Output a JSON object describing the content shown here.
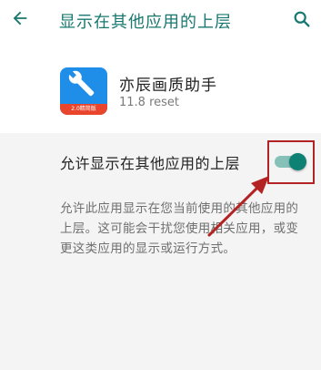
{
  "toolbar": {
    "title": "显示在其他应用的上层",
    "back_icon": "arrow-left-icon",
    "search_icon": "search-icon"
  },
  "app": {
    "name": "亦辰画质助手",
    "version": "11.8 reset",
    "icon": "wrench-icon",
    "icon_banner": "2.0精简版"
  },
  "setting": {
    "label": "允许显示在其他应用的上层",
    "enabled": true,
    "description": "允许此应用显示在您当前使用的其他应用的上层。这可能会干扰您使用相关应用，或变更这类应用的显示或运行方式。"
  },
  "colors": {
    "accent": "#18786f",
    "toggle_thumb": "#0d8173",
    "toggle_track": "#85c0b9",
    "annotation": "#b32324",
    "app_icon_bg": "#1f8ee8"
  }
}
